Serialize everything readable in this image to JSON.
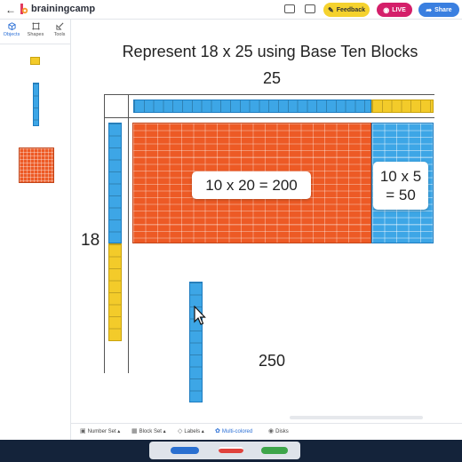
{
  "header": {
    "brand": "brainingcamp",
    "feedback_label": "Feedback",
    "live_label": "LIVE",
    "share_label": "Share",
    "colors": {
      "feedback": "#f5d22e",
      "live": "#d41f6a",
      "share": "#3a7fe0"
    }
  },
  "rail": {
    "tabs": [
      {
        "label": "Objects",
        "icon": "cube-icon"
      },
      {
        "label": "Shapes",
        "icon": "shapes-icon"
      },
      {
        "label": "Tools",
        "icon": "ruler-icon"
      }
    ]
  },
  "workspace": {
    "title": "Represent 18 x 25 using Base Ten Blocks",
    "top_label": "25",
    "side_label": "18",
    "product_tens": "10 x 20 = 200",
    "product_ones_line1": "10 x 5",
    "product_ones_line2": "= 50",
    "partial_total": "250"
  },
  "toolbar": {
    "number_set": "Number Set",
    "block_set": "Block Set",
    "labels": "Labels",
    "multi_colored": "Multi-colored",
    "disks": "Disks"
  }
}
